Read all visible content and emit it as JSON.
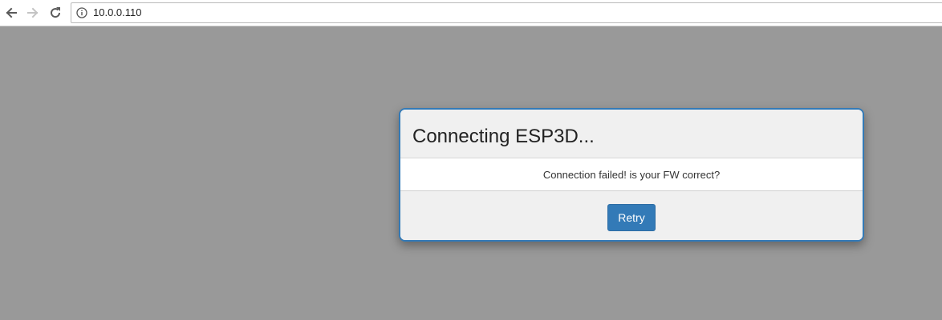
{
  "browser": {
    "url": "10.0.0.110",
    "icons": {
      "back": "back-arrow-icon",
      "forward": "forward-arrow-icon",
      "reload": "reload-icon",
      "site_info": "info-icon"
    }
  },
  "modal": {
    "title": "Connecting ESP3D...",
    "message": "Connection failed! is your FW correct?",
    "retry_label": "Retry"
  },
  "colors": {
    "overlay": "#999999",
    "accent": "#337ab7",
    "modal_bg": "#f0f0f0"
  }
}
